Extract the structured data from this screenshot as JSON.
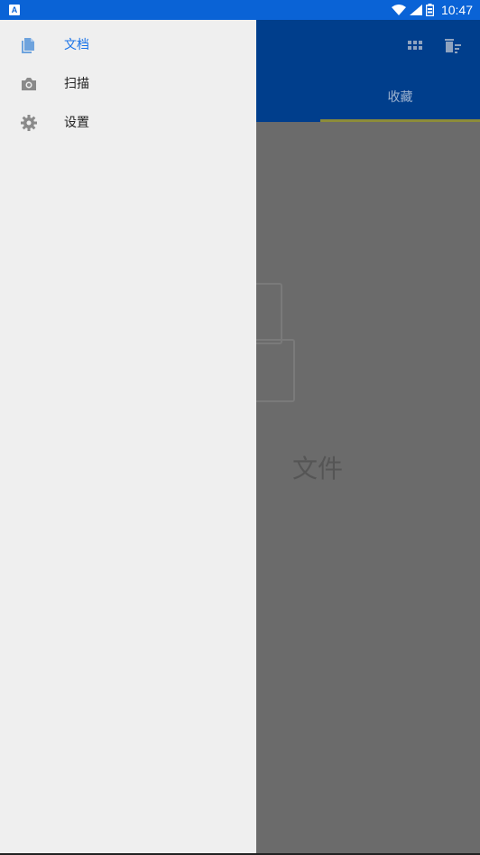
{
  "status_bar": {
    "time": "10:47",
    "notification_glyph": "A",
    "icons": [
      "wifi-icon",
      "signal-icon",
      "battery-icon"
    ]
  },
  "background": {
    "tab_favorites": "收藏",
    "empty_state_text": "文件",
    "actions": [
      "grid-view-icon",
      "delete-sort-icon"
    ]
  },
  "drawer": {
    "items": [
      {
        "label": "文档",
        "icon": "document-icon",
        "active": true
      },
      {
        "label": "扫描",
        "icon": "camera-icon",
        "active": false
      },
      {
        "label": "设置",
        "icon": "gear-icon",
        "active": false
      }
    ]
  },
  "colors": {
    "status_bar": "#0a63d6",
    "app_bar": "#003e8c",
    "accent": "#1a73e8",
    "drawer_bg": "#efefef",
    "scrim": "#6b6b6b"
  }
}
